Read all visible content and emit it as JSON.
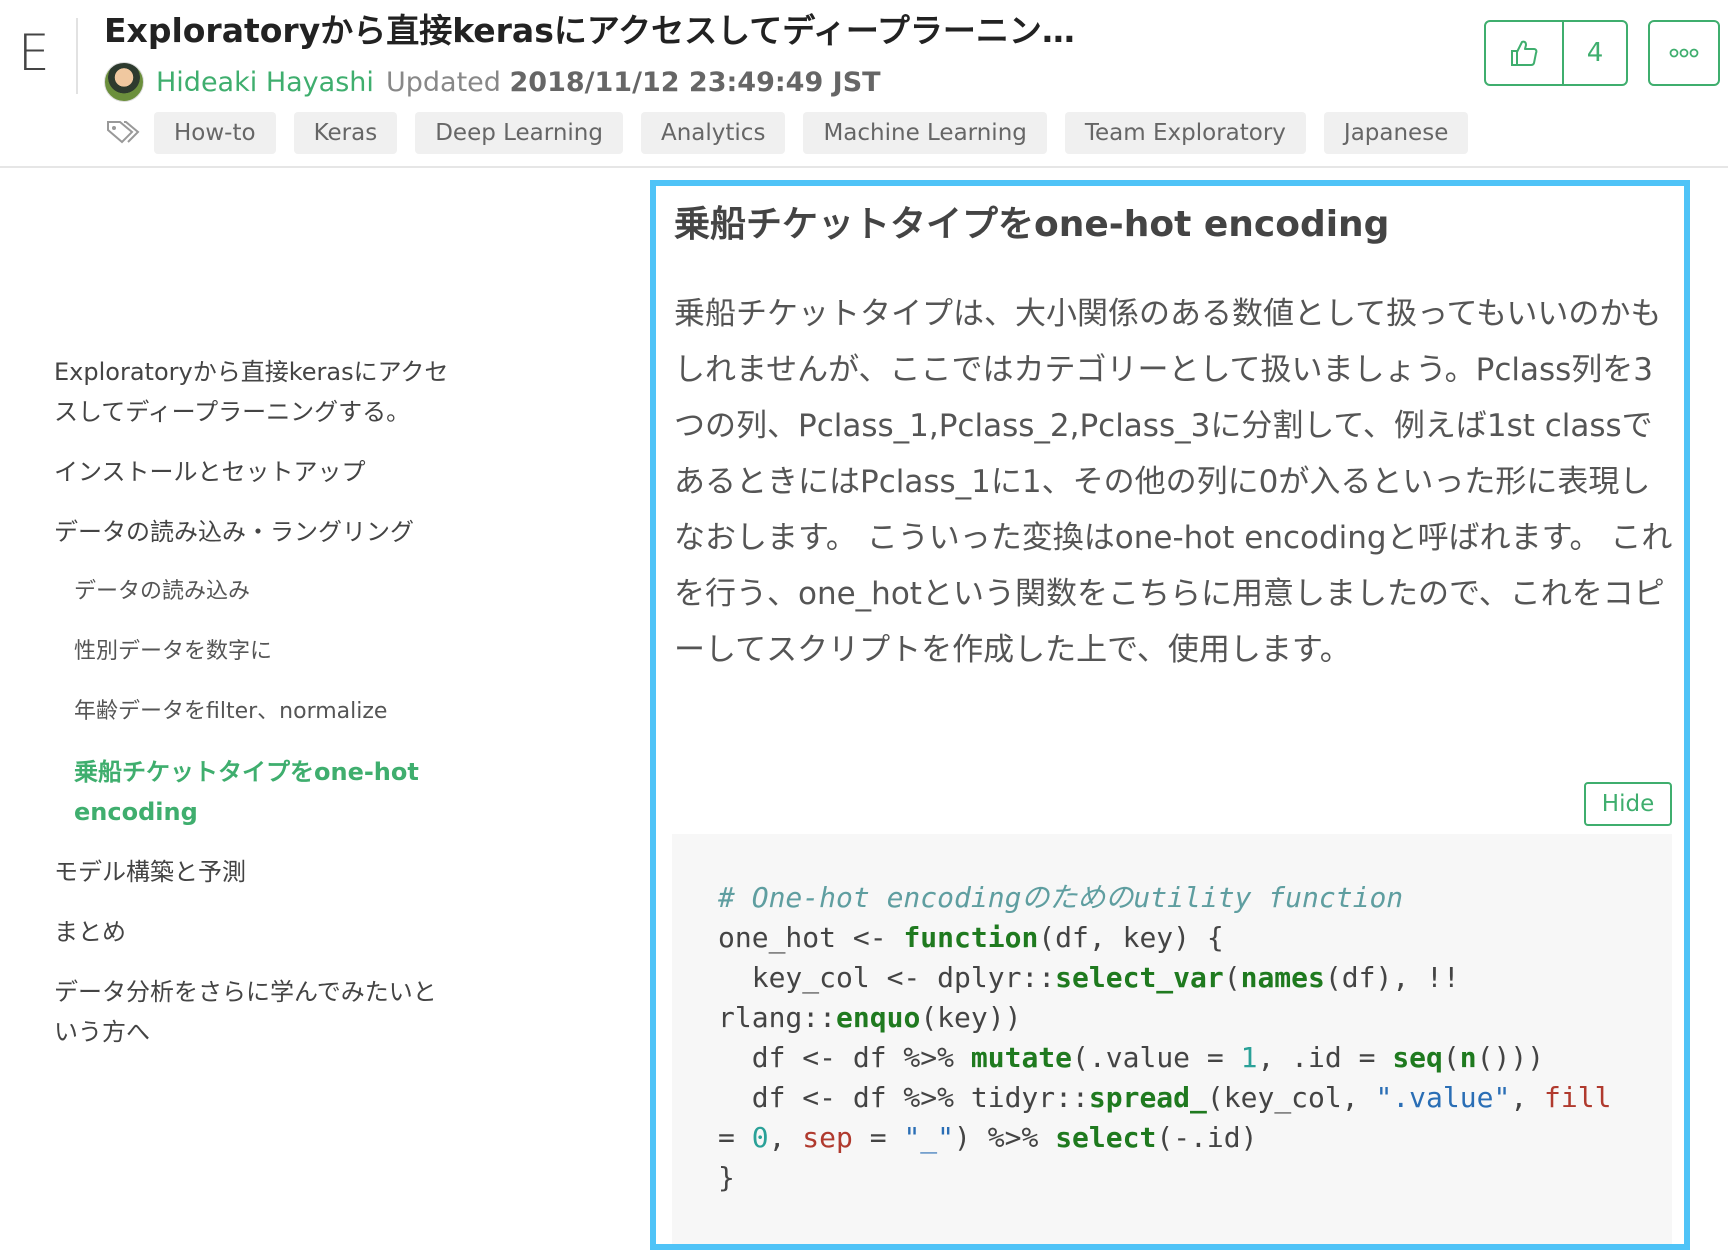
{
  "header": {
    "logo": "E",
    "title": "Exploratoryから直接kerasにアクセスしてディープラーニン…",
    "author": "Hideaki Hayashi",
    "updated_label": "Updated",
    "updated_value": "2018/11/12 23:49:49 JST",
    "tags": [
      "How-to",
      "Keras",
      "Deep Learning",
      "Analytics",
      "Machine Learning",
      "Team Exploratory",
      "Japanese"
    ],
    "like_count": "4",
    "accent_color": "#3fae6e"
  },
  "toc": {
    "items": [
      {
        "label": "Exploratoryから直接kerasにアクセスしてディープラーニングする。",
        "level": 1
      },
      {
        "label": "インストールとセットアップ",
        "level": 1
      },
      {
        "label": "データの読み込み・ラングリング",
        "level": 1
      },
      {
        "label": "データの読み込み",
        "level": 2
      },
      {
        "label": "性別データを数字に",
        "level": 2
      },
      {
        "label": "年齢データをfilter、normalize",
        "level": 2
      },
      {
        "label": "乗船チケットタイプをone-hot encoding",
        "level": 2,
        "active": true
      },
      {
        "label": "モデル構築と予測",
        "level": 1
      },
      {
        "label": "まとめ",
        "level": 1
      },
      {
        "label": "データ分析をさらに学んでみたいという方へ",
        "level": 1
      }
    ]
  },
  "content": {
    "section_title": "乗船チケットタイプをone-hot encoding",
    "body": "乗船チケットタイプは、大小関係のある数値として扱ってもいいのかもしれませんが、ここではカテゴリーとして扱いましょう。Pclass列を3つの列、Pclass_1,Pclass_2,Pclass_3に分割して、例えば1st classであるときにはPclass_1に1、その他の列に0が入るといった形に表現しなおします。 こういった変換はone-hot encodingと呼ばれます。 これを行う、one_hotという関数をこちらに用意しましたので、これをコピーしてスクリプトを作成した上で、使用します。",
    "hide_label": "Hide",
    "highlight_color": "#4fc3f7"
  },
  "code": {
    "lines": [
      "# One-hot encodingのためのutility function",
      "one_hot <- function(df, key) {",
      "  key_col <- dplyr::select_var(names(df), !!",
      "rlang::enquo(key))",
      "  df <- df %>% mutate(.value = 1, .id = seq(n()))",
      "  df <- df %>% tidyr::spread_(key_col, \".value\", fill",
      "= 0, sep = \"_\") %>% select(-.id)",
      "}"
    ]
  }
}
